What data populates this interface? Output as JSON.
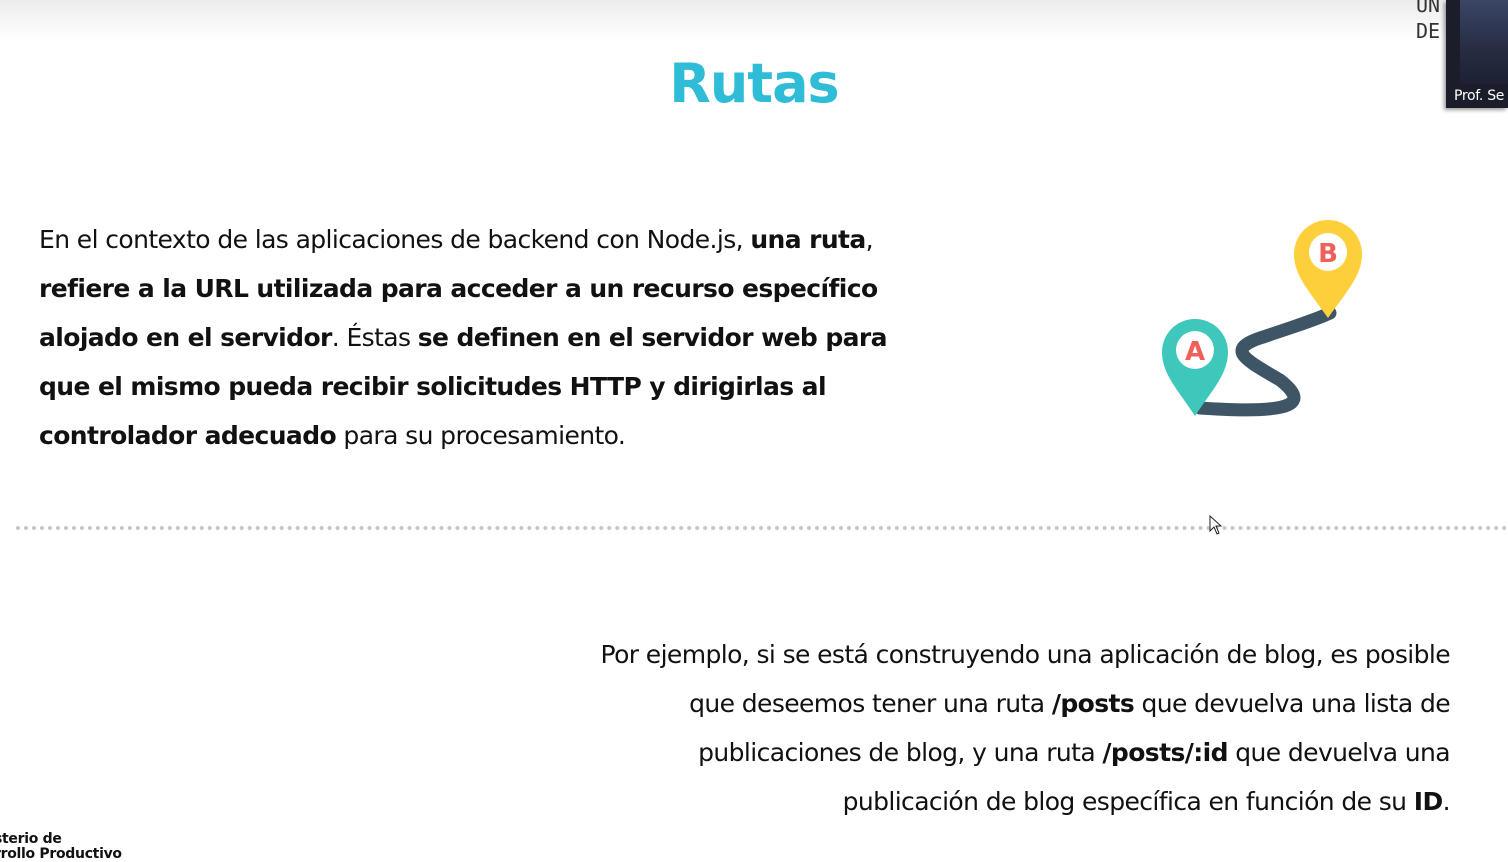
{
  "slide": {
    "title": "Rutas",
    "paragraph1": [
      {
        "text": "En el contexto de las aplicaciones de backend con Node.js, ",
        "bold": false
      },
      {
        "text": "una ruta",
        "bold": true
      },
      {
        "text": ", ",
        "bold": false
      },
      {
        "text": "refiere a la URL utilizada para acceder a un recurso específico alojado en el servidor",
        "bold": true
      },
      {
        "text": ". Éstas ",
        "bold": false
      },
      {
        "text": "se definen en el servidor web para que el mismo pueda recibir solicitudes HTTP y dirigirlas al controlador adecuado",
        "bold": true
      },
      {
        "text": " para su procesamiento.",
        "bold": false
      }
    ],
    "paragraph2": [
      {
        "text": "Por ejemplo, si se está construyendo una aplicación de blog, es posible que deseemos tener una ruta ",
        "bold": false
      },
      {
        "text": "/posts",
        "bold": true
      },
      {
        "text": " que devuelva una lista de publicaciones de blog, y una ruta ",
        "bold": false
      },
      {
        "text": "/posts/:id",
        "bold": true
      },
      {
        "text": " que devuelva una publicación de blog específica en función de su ",
        "bold": false
      },
      {
        "text": "ID",
        "bold": true
      },
      {
        "text": ".",
        "bold": false
      }
    ],
    "illustration": {
      "icon": "route-map-pins-icon",
      "pin_a_label": "A",
      "pin_b_label": "B",
      "pin_a_color": "#3ec8bb",
      "pin_b_color": "#fdd03b",
      "letter_color": "#f0605a",
      "path_color": "#3e5566"
    },
    "accent_color": "#2ebcd6",
    "footer_lines": [
      "sterio de",
      "rrollo Productivo"
    ]
  },
  "video_tile": {
    "participant_name": "Prof. Se",
    "background_text": [
      "UN",
      "DE"
    ]
  }
}
